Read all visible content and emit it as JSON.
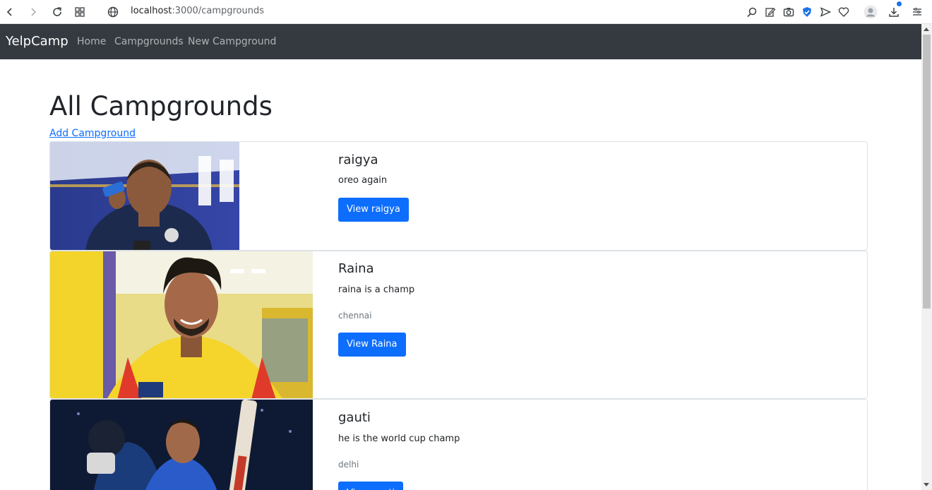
{
  "browser": {
    "url_host": "localhost",
    "url_path": ":3000/campgrounds",
    "icons": [
      "back-icon",
      "forward-icon",
      "reload-icon",
      "tabs-grid-icon",
      "site-info-icon",
      "search-icon",
      "edit-icon",
      "camera-icon",
      "shield-icon",
      "send-icon",
      "heart-icon",
      "profile-icon",
      "download-icon",
      "menu-icon"
    ]
  },
  "navbar": {
    "brand": "YelpCamp",
    "links": [
      "Home",
      "Campgrounds",
      "New Campground"
    ],
    "bg_color": "#343a40"
  },
  "main": {
    "title": "All Campgrounds",
    "add_link": "Add Campground",
    "campgrounds": [
      {
        "title": "raigya",
        "description": "oreo again",
        "location": "",
        "button": "View raigya"
      },
      {
        "title": "Raina",
        "description": "raina is a champ",
        "location": "chennai",
        "button": "View Raina"
      },
      {
        "title": "gauti",
        "description": "he is the world cup champ",
        "location": "delhi",
        "button": "View gauti"
      }
    ]
  },
  "colors": {
    "primary": "#0d6efd",
    "muted": "#6c757d"
  }
}
